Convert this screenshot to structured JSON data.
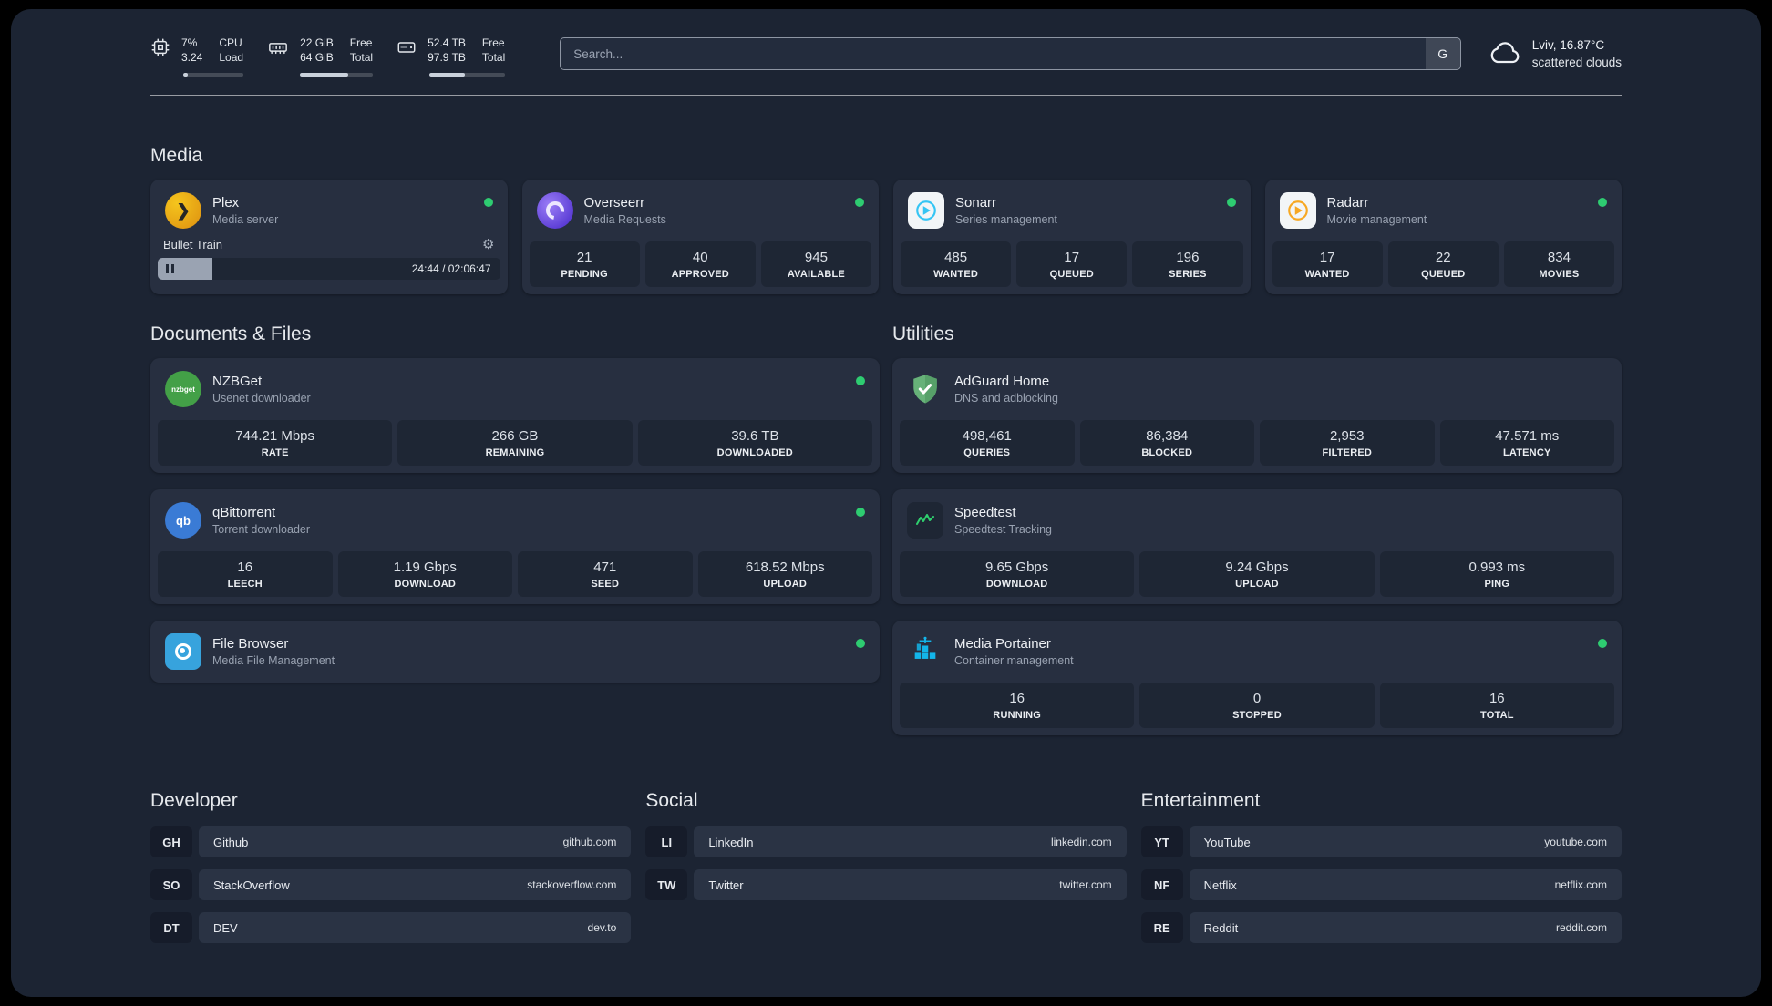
{
  "colors": {
    "background": "#1c2433",
    "card": "#272f40",
    "tile": "#1e2634",
    "status_green": "#2ecc71"
  },
  "topbar": {
    "cpu": {
      "value1": "7%",
      "value2": "3.24",
      "label1": "CPU",
      "label2": "Load",
      "progress": 7
    },
    "ram": {
      "value1": "22 GiB",
      "value2": "64 GiB",
      "label1": "Free",
      "label2": "Total",
      "progress": 66
    },
    "disk": {
      "value1": "52.4 TB",
      "value2": "97.9 TB",
      "label1": "Free",
      "label2": "Total",
      "progress": 47
    },
    "search": {
      "placeholder": "Search...",
      "provider": "G"
    },
    "weather": {
      "location": "Lviv, 16.87°C",
      "condition": "scattered clouds"
    }
  },
  "sections": {
    "media": {
      "title": "Media",
      "cards": [
        {
          "name": "Plex",
          "desc": "Media server",
          "status": "online",
          "player": {
            "track": "Bullet Train",
            "time": "24:44 / 02:06:47",
            "progress": 16
          }
        },
        {
          "name": "Overseerr",
          "desc": "Media Requests",
          "status": "online",
          "stats": [
            {
              "value": "21",
              "label": "PENDING"
            },
            {
              "value": "40",
              "label": "APPROVED"
            },
            {
              "value": "945",
              "label": "AVAILABLE"
            }
          ]
        },
        {
          "name": "Sonarr",
          "desc": "Series management",
          "status": "online",
          "stats": [
            {
              "value": "485",
              "label": "WANTED"
            },
            {
              "value": "17",
              "label": "QUEUED"
            },
            {
              "value": "196",
              "label": "SERIES"
            }
          ]
        },
        {
          "name": "Radarr",
          "desc": "Movie management",
          "status": "online",
          "stats": [
            {
              "value": "17",
              "label": "WANTED"
            },
            {
              "value": "22",
              "label": "QUEUED"
            },
            {
              "value": "834",
              "label": "MOVIES"
            }
          ]
        }
      ]
    },
    "documents": {
      "title": "Documents & Files",
      "cards": [
        {
          "name": "NZBGet",
          "desc": "Usenet downloader",
          "status": "online",
          "stats": [
            {
              "value": "744.21 Mbps",
              "label": "RATE"
            },
            {
              "value": "266 GB",
              "label": "REMAINING"
            },
            {
              "value": "39.6 TB",
              "label": "DOWNLOADED"
            }
          ]
        },
        {
          "name": "qBittorrent",
          "desc": "Torrent downloader",
          "status": "online",
          "stats": [
            {
              "value": "16",
              "label": "LEECH"
            },
            {
              "value": "1.19 Gbps",
              "label": "DOWNLOAD"
            },
            {
              "value": "471",
              "label": "SEED"
            },
            {
              "value": "618.52 Mbps",
              "label": "UPLOAD"
            }
          ]
        },
        {
          "name": "File Browser",
          "desc": "Media File Management",
          "status": "online"
        }
      ]
    },
    "utilities": {
      "title": "Utilities",
      "cards": [
        {
          "name": "AdGuard Home",
          "desc": "DNS and adblocking",
          "stats": [
            {
              "value": "498,461",
              "label": "QUERIES"
            },
            {
              "value": "86,384",
              "label": "BLOCKED"
            },
            {
              "value": "2,953",
              "label": "FILTERED"
            },
            {
              "value": "47.571 ms",
              "label": "LATENCY"
            }
          ]
        },
        {
          "name": "Speedtest",
          "desc": "Speedtest Tracking",
          "stats": [
            {
              "value": "9.65 Gbps",
              "label": "DOWNLOAD"
            },
            {
              "value": "9.24 Gbps",
              "label": "UPLOAD"
            },
            {
              "value": "0.993 ms",
              "label": "PING"
            }
          ]
        },
        {
          "name": "Media Portainer",
          "desc": "Container management",
          "status": "online",
          "stats": [
            {
              "value": "16",
              "label": "RUNNING"
            },
            {
              "value": "0",
              "label": "STOPPED"
            },
            {
              "value": "16",
              "label": "TOTAL"
            }
          ]
        }
      ]
    }
  },
  "bookmarks": {
    "groups": [
      {
        "title": "Developer",
        "items": [
          {
            "abbr": "GH",
            "name": "Github",
            "url": "github.com"
          },
          {
            "abbr": "SO",
            "name": "StackOverflow",
            "url": "stackoverflow.com"
          },
          {
            "abbr": "DT",
            "name": "DEV",
            "url": "dev.to"
          }
        ]
      },
      {
        "title": "Social",
        "items": [
          {
            "abbr": "LI",
            "name": "LinkedIn",
            "url": "linkedin.com"
          },
          {
            "abbr": "TW",
            "name": "Twitter",
            "url": "twitter.com"
          }
        ]
      },
      {
        "title": "Entertainment",
        "items": [
          {
            "abbr": "YT",
            "name": "YouTube",
            "url": "youtube.com"
          },
          {
            "abbr": "NF",
            "name": "Netflix",
            "url": "netflix.com"
          },
          {
            "abbr": "RE",
            "name": "Reddit",
            "url": "reddit.com"
          }
        ]
      }
    ]
  }
}
